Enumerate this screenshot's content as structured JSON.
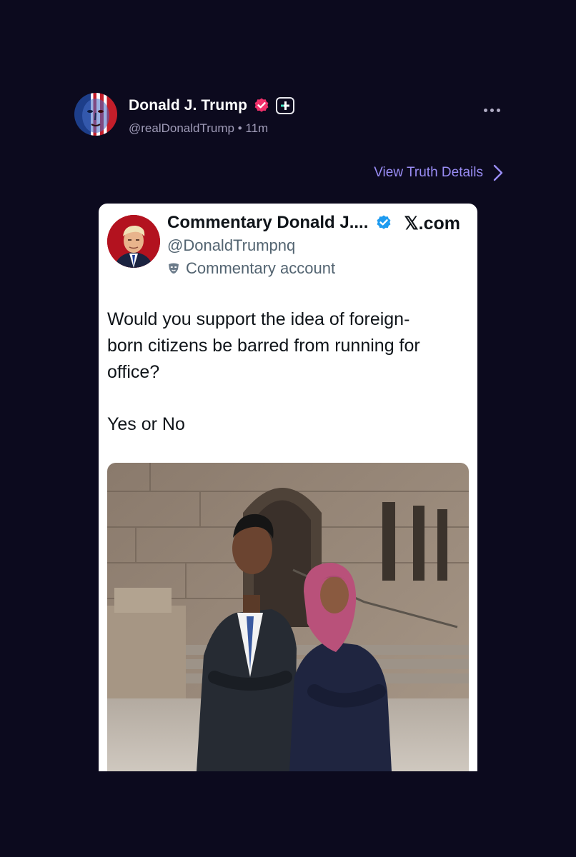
{
  "post": {
    "author_name": "Donald J. Trump",
    "author_handle": "@realDonaldTrump",
    "separator": "•",
    "time_ago": "11m",
    "avatar_icon": "patriotic-face-avatar",
    "verified_icon": "verified-badge-icon",
    "verified_color": "#f0306a",
    "plus_icon": "truth-plus-icon",
    "more_icon": "more-options-icon"
  },
  "view_details": {
    "label": "View Truth Details",
    "icon": "chevron-right-icon",
    "color": "#9a8df5"
  },
  "embedded_tweet": {
    "display_name": "Commentary Donald J....",
    "handle": "@DonaldTrumpnq",
    "account_type": "Commentary account",
    "account_type_icon": "mask-icon",
    "source": "𝕏.com",
    "verified_icon": "blue-check-icon",
    "verified_color": "#1d9bf0",
    "text_lines": [
      "Would you support the idea of foreign-",
      "born citizens be barred from running for",
      "office?"
    ],
    "text_line_2": "Yes or No",
    "photo_icon": "photo-two-people-government-building"
  },
  "colors": {
    "background": "#0c0a1e",
    "card": "#ffffff"
  }
}
